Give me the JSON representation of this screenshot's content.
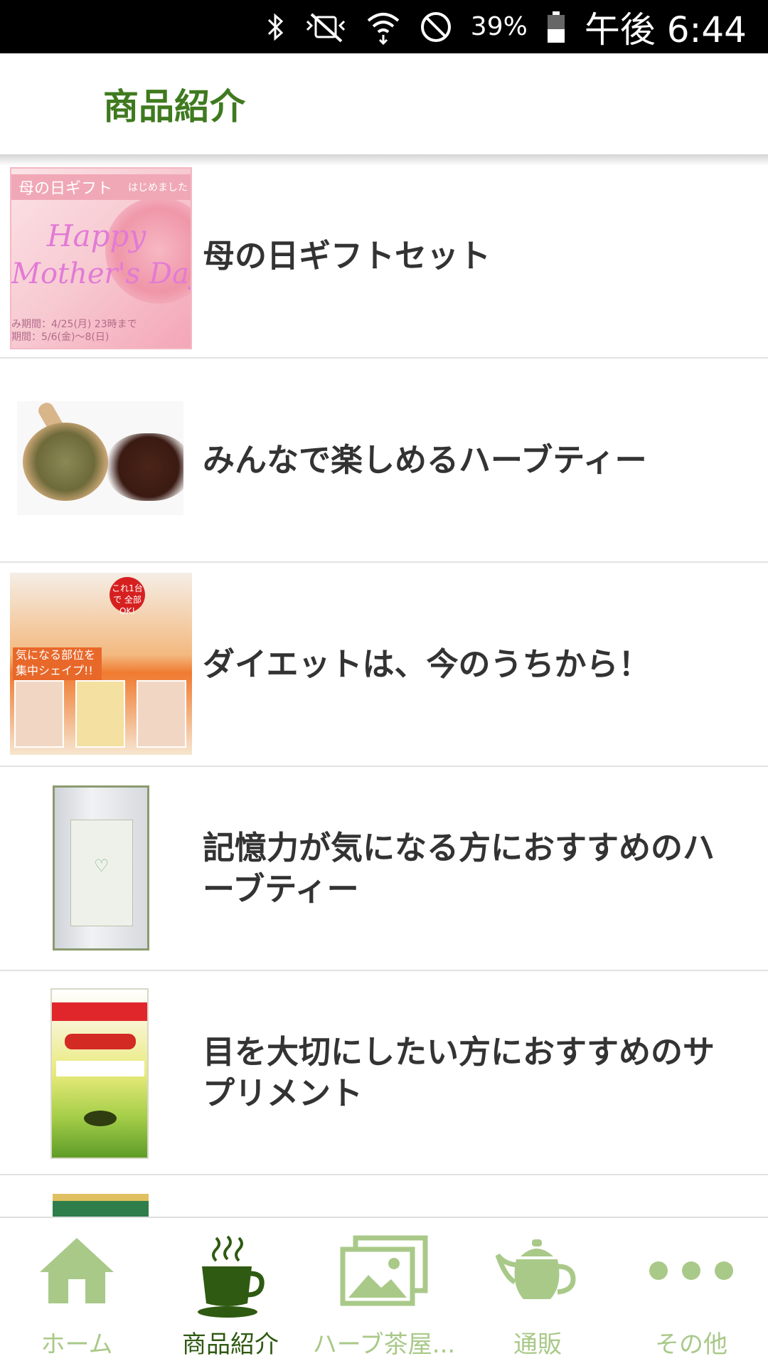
{
  "status_bar": {
    "battery": "39%",
    "time": "午後 6:44",
    "icons": [
      "bluetooth-icon",
      "vibrate-icon",
      "wifi-icon",
      "do-not-disturb-icon",
      "battery-icon"
    ]
  },
  "header": {
    "title": "商品紹介"
  },
  "products": [
    {
      "title": "母の日ギフトセット",
      "thumb": {
        "banner": "母の日ギフト",
        "banner_sub": "はじめました",
        "script1": "Happy",
        "script2": "Mother's Day",
        "date1": "み期間：4/25(月) 23時まで",
        "date2": "期間：5/6(金)〜8(日)"
      }
    },
    {
      "title": "みんなで楽しめるハーブティー"
    },
    {
      "title": "ダイエットは、今のうちから！",
      "thumb": {
        "label": "気になる部位を 集中シェイプ!!",
        "badge": "これ1台で 全部OK!"
      }
    },
    {
      "title": "記憶力が気になる方におすすめのハーブティー"
    },
    {
      "title": "目を大切にしたい方におすすめのサプリメント"
    },
    {
      "title": ""
    }
  ],
  "bottom_nav": {
    "items": [
      {
        "label": "ホーム",
        "icon": "home-icon"
      },
      {
        "label": "商品紹介",
        "icon": "tea-cup-icon"
      },
      {
        "label": "ハーブ茶屋...",
        "icon": "gallery-icon"
      },
      {
        "label": "通販",
        "icon": "teapot-icon"
      },
      {
        "label": "その他",
        "icon": "more-icon"
      }
    ],
    "active_index": 1
  },
  "colors": {
    "accent": "#3f7a1f",
    "nav_active": "#2f5a12",
    "nav_inactive": "#a9c989",
    "text": "#333333"
  }
}
